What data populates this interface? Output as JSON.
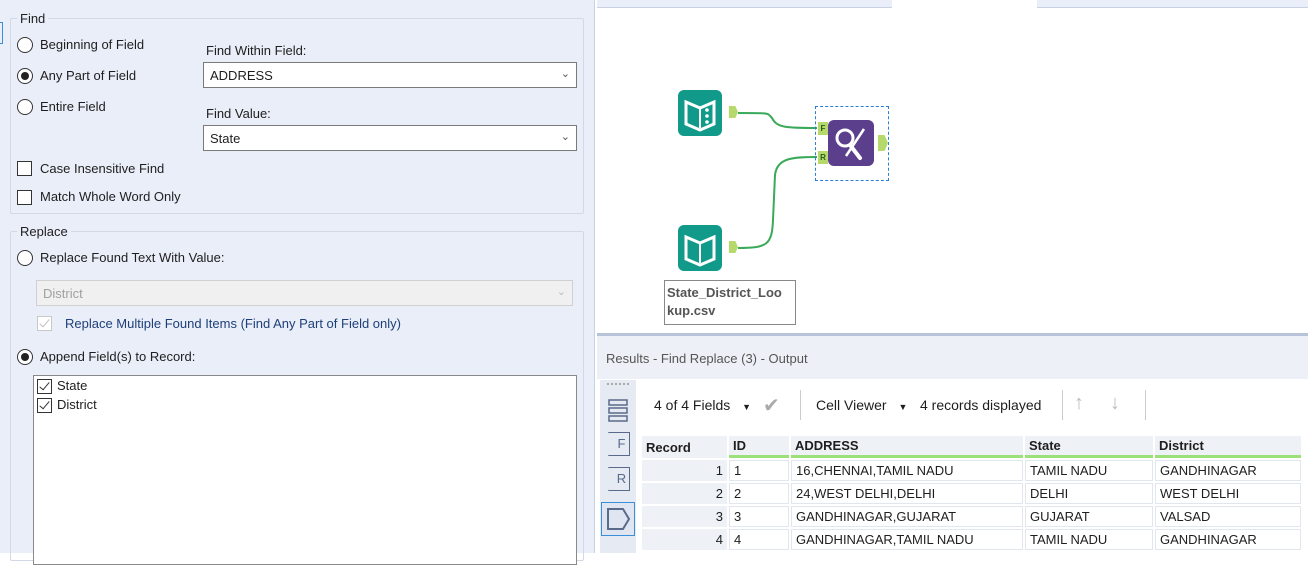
{
  "find": {
    "group_label": "Find",
    "options": [
      {
        "label": "Beginning of Field",
        "selected": false
      },
      {
        "label": "Any Part of Field",
        "selected": true
      },
      {
        "label": "Entire Field",
        "selected": false
      }
    ],
    "find_within_label": "Find Within Field:",
    "find_within_value": "ADDRESS",
    "find_value_label": "Find Value:",
    "find_value_value": "State",
    "case_insensitive_label": "Case Insensitive Find",
    "case_insensitive_checked": false,
    "match_whole_label": "Match Whole Word Only",
    "match_whole_checked": false
  },
  "replace": {
    "group_label": "Replace",
    "replace_found_label": "Replace Found Text With Value:",
    "replace_value": "District",
    "replace_multiple_label": "Replace Multiple Found Items (Find Any Part of Field only)",
    "append_label": "Append Field(s) to Record:",
    "append_fields": [
      {
        "label": "State",
        "checked": true
      },
      {
        "label": "District",
        "checked": true
      }
    ]
  },
  "canvas": {
    "lookup_label_line1": "State_District_Loo",
    "lookup_label_line2": "kup.csv",
    "port_f": "F",
    "port_r": "R"
  },
  "results": {
    "title": "Results - Find Replace (3) - Output",
    "fields_label": "4 of 4 Fields",
    "cell_viewer_label": "Cell Viewer",
    "records_label": "4 records displayed",
    "side_f": "F",
    "side_r": "R",
    "columns": [
      "Record",
      "ID",
      "ADDRESS",
      "State",
      "District"
    ],
    "rows": [
      [
        "1",
        "1",
        "16,CHENNAI,TAMIL NADU",
        "TAMIL NADU",
        "GANDHINAGAR"
      ],
      [
        "2",
        "2",
        "24,WEST DELHI,DELHI",
        "DELHI",
        "WEST DELHI"
      ],
      [
        "3",
        "3",
        "GANDHINAGAR,GUJARAT",
        "GUJARAT",
        "VALSAD"
      ],
      [
        "4",
        "4",
        "GANDHINAGAR,TAMIL NADU",
        "TAMIL NADU",
        "GANDHINAGAR"
      ]
    ]
  },
  "colors": {
    "tool_teal": "#119a8a",
    "tool_purple": "#5b3f8c",
    "connection": "#3aaa5a",
    "port": "#b5d96a"
  }
}
